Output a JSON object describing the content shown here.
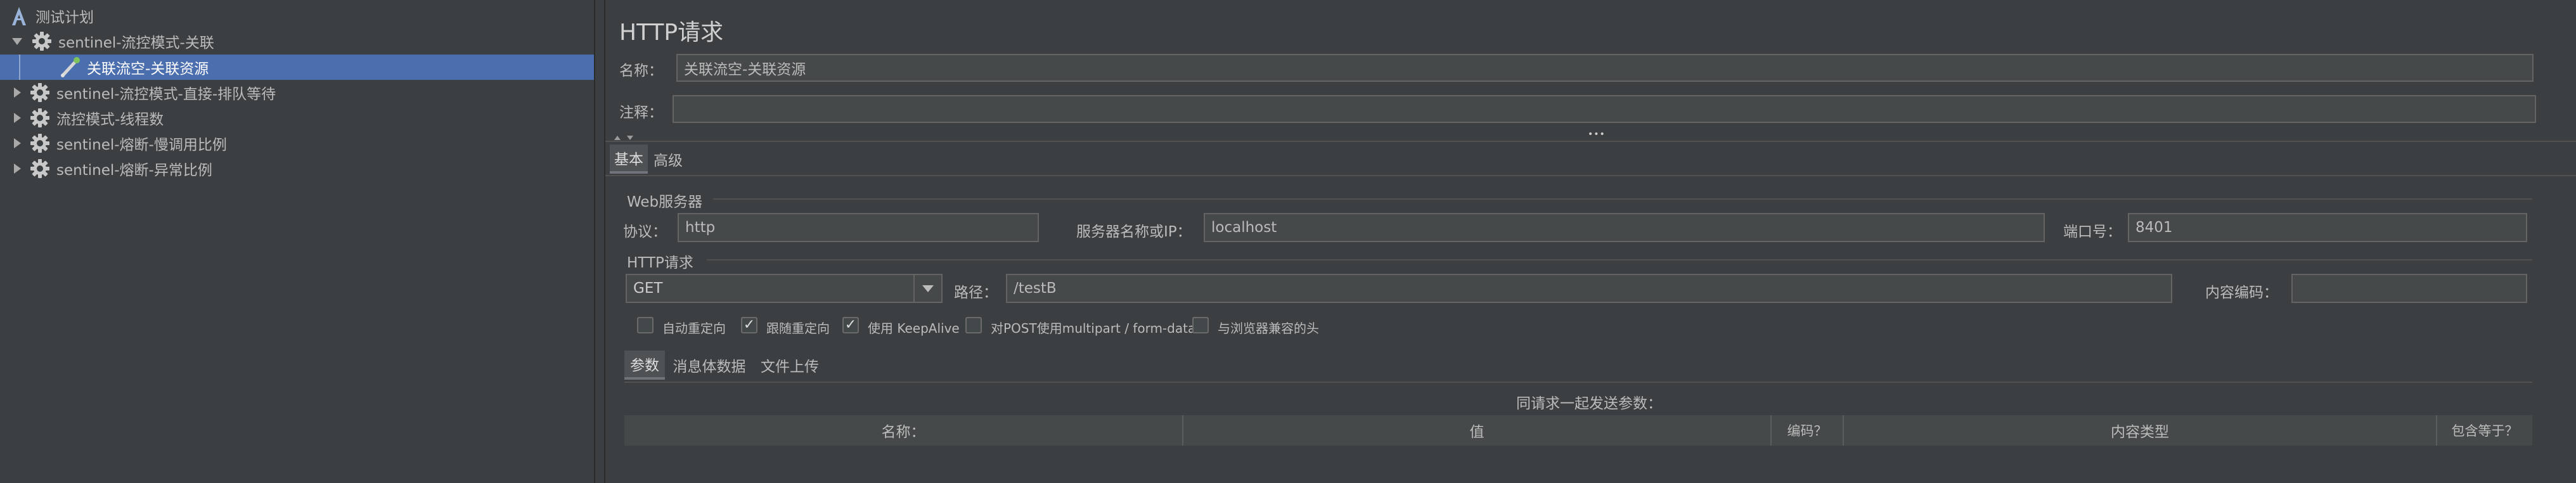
{
  "tree": {
    "items": [
      {
        "label": "测试计划",
        "icon": "test-plan-icon"
      },
      {
        "label": "sentinel-流控模式-关联",
        "icon": "gear-icon",
        "expanded": true
      },
      {
        "label": "关联流空-关联资源",
        "icon": "sampler-icon",
        "selected": true
      },
      {
        "label": "sentinel-流控模式-直接-排队等待",
        "icon": "gear-icon",
        "expanded": false
      },
      {
        "label": "流控模式-线程数",
        "icon": "gear-icon",
        "expanded": false
      },
      {
        "label": "sentinel-熔断-慢调用比例",
        "icon": "gear-icon",
        "expanded": false
      },
      {
        "label": "sentinel-熔断-异常比例",
        "icon": "gear-icon",
        "expanded": false
      }
    ]
  },
  "panel": {
    "title": "HTTP请求",
    "name_label": "名称：",
    "name_value": "关联流空-关联资源",
    "comment_label": "注释：",
    "comment_value": "",
    "splitter_dots": "•••",
    "tabs": {
      "basic": "基本",
      "advanced": "高级"
    },
    "web_server": {
      "section_label": "Web服务器",
      "protocol_label": "协议：",
      "protocol_value": "http",
      "server_label": "服务器名称或IP：",
      "server_value": "localhost",
      "port_label": "端口号：",
      "port_value": "8401"
    },
    "http_request": {
      "section_label": "HTTP请求",
      "method": "GET",
      "path_label": "路径：",
      "path_value": "/testB",
      "encoding_label": "内容编码：",
      "encoding_value": ""
    },
    "options": [
      {
        "label": "自动重定向",
        "checked": false
      },
      {
        "label": "跟随重定向",
        "checked": true
      },
      {
        "label": "使用 KeepAlive",
        "checked": true
      },
      {
        "label": "对POST使用multipart / form-data",
        "checked": false
      },
      {
        "label": "与浏览器兼容的头",
        "checked": false
      }
    ],
    "sub_tabs": {
      "params": "参数",
      "body": "消息体数据",
      "upload": "文件上传"
    },
    "params_caption": "同请求一起发送参数：",
    "columns": [
      "名称：",
      "值",
      "编码？",
      "内容类型",
      "包含等于？"
    ]
  },
  "colors": {
    "background": "#3c3f41",
    "selection": "#4b6eaf",
    "field_bg": "#45494a"
  }
}
